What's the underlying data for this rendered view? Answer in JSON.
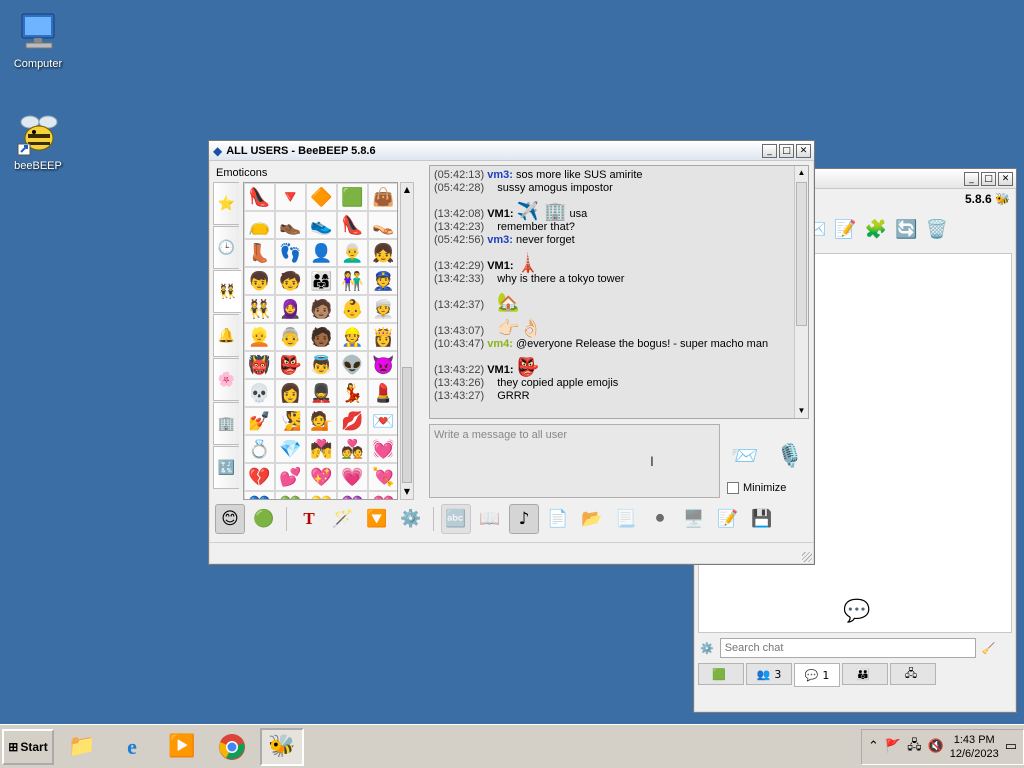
{
  "desktop": {
    "icons": [
      {
        "label": "Computer"
      },
      {
        "label": "beeBEEP"
      }
    ]
  },
  "chat_window": {
    "title": "ALL USERS - BeeBEEP 5.8.6",
    "emoticons_label": "Emoticons",
    "emoji_grid": [
      "👠",
      "🔻",
      "🔶",
      "🟩",
      "👜",
      "👝",
      "👞",
      "👟",
      "👠",
      "👡",
      "👢",
      "👣",
      "👤",
      "👨‍🦳",
      "👧",
      "👦",
      "🧒",
      "👨‍👩‍👧",
      "👫",
      "👮",
      "👯",
      "🧕",
      "🧑🏽",
      "👶",
      "👳",
      "👱",
      "👵",
      "🧑🏾",
      "👷",
      "👸",
      "👹",
      "👺",
      "👼",
      "👽",
      "👿",
      "💀",
      "👩",
      "💂",
      "💃",
      "💄",
      "💅",
      "🧏",
      "💁",
      "💋",
      "💌",
      "💍",
      "💎",
      "💏",
      "💑",
      "💓",
      "💔",
      "💕",
      "💖",
      "💗",
      "💘",
      "💙",
      "💚",
      "💛",
      "💜",
      "💝"
    ],
    "messages": [
      {
        "ts": "(05:42:13)",
        "user": "vm3",
        "ucls": "u-vm3",
        "text": "sos more like SUS amirite"
      },
      {
        "ts": "(05:42:28)",
        "text": "sussy amogus impostor"
      },
      {
        "ts": "(13:42:08)",
        "user": "VM1",
        "ucls": "u-vm1",
        "emoji": "✈️ 🏢",
        "text": "usa",
        "gap": true
      },
      {
        "ts": "(13:42:23)",
        "text": "remember that?"
      },
      {
        "ts": "(05:42:56)",
        "user": "vm3",
        "ucls": "u-vm3",
        "text": "never forget"
      },
      {
        "ts": "(13:42:29)",
        "user": "VM1",
        "ucls": "u-vm1",
        "emoji": "🗼",
        "text": "",
        "gap": true
      },
      {
        "ts": "(13:42:33)",
        "text": "why is there a tokyo tower"
      },
      {
        "ts": "(13:42:37)",
        "emoji": "🏡",
        "text": "",
        "gap": true
      },
      {
        "ts": "(13:43:07)",
        "emoji": "👉🏻👌🏻",
        "text": "",
        "gap": true
      },
      {
        "ts": "(10:43:47)",
        "user": "vm4",
        "ucls": "u-vm4",
        "text": "@everyone Release the bogus! - super macho man"
      },
      {
        "ts": "(13:43:22)",
        "user": "VM1",
        "ucls": "u-vm1",
        "emoji": "👺",
        "text": "",
        "gap": true
      },
      {
        "ts": "(13:43:26)",
        "text": "they copied apple emojis"
      },
      {
        "ts": "(13:43:27)",
        "text": "GRRR"
      }
    ],
    "input_placeholder": "Write a message to all user",
    "minimize_label": "Minimize"
  },
  "main_window": {
    "version": "5.8.6",
    "search_placeholder": "Search chat",
    "tabs": [
      {
        "badge": ""
      },
      {
        "badge": "3"
      },
      {
        "badge": "1"
      },
      {
        "badge": ""
      },
      {
        "badge": ""
      }
    ]
  },
  "taskbar": {
    "start_label": "Start",
    "time": "1:43 PM",
    "date": "12/6/2023"
  }
}
